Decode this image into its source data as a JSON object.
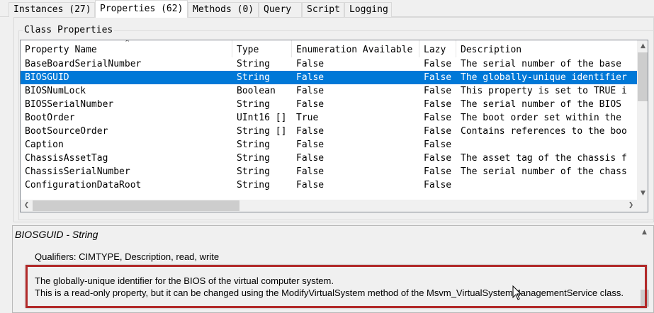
{
  "tabs": [
    {
      "label": "Instances (27)",
      "active": false
    },
    {
      "label": "Properties (62)",
      "active": true
    },
    {
      "label": "Methods (0)",
      "active": false
    },
    {
      "label": "Query",
      "active": false
    },
    {
      "label": "Script",
      "active": false
    },
    {
      "label": "Logging",
      "active": false
    }
  ],
  "class_properties": {
    "group_label": "Class Properties",
    "columns": [
      "Property Name",
      "Type",
      "Enumeration Available",
      "Lazy",
      "Description"
    ],
    "selected_index": 1,
    "rows": [
      [
        "BaseBoardSerialNumber",
        "String",
        "False",
        "False",
        "The serial number of the base"
      ],
      [
        "BIOSGUID",
        "String",
        "False",
        "False",
        "The globally-unique identifier"
      ],
      [
        "BIOSNumLock",
        "Boolean",
        "False",
        "False",
        "This property is set to TRUE i"
      ],
      [
        "BIOSSerialNumber",
        "String",
        "False",
        "False",
        "The serial number of the BIOS"
      ],
      [
        "BootOrder",
        "UInt16 []",
        "True",
        "False",
        "The boot order set within the"
      ],
      [
        "BootSourceOrder",
        "String []",
        "False",
        "False",
        "Contains references to the boo"
      ],
      [
        "Caption",
        "String",
        "False",
        "False",
        ""
      ],
      [
        "ChassisAssetTag",
        "String",
        "False",
        "False",
        "The asset tag of the chassis f"
      ],
      [
        "ChassisSerialNumber",
        "String",
        "False",
        "False",
        "The serial number of the chass"
      ],
      [
        "ConfigurationDataRoot",
        "String",
        "False",
        "False",
        ""
      ]
    ]
  },
  "detail": {
    "title": "BIOSGUID - String",
    "qualifiers": "Qualifiers: CIMTYPE, Description, read, write",
    "description_line1": "The globally-unique identifier for the BIOS of the virtual computer system.",
    "description_line2": "This is a read-only property, but it can be changed using the ModifyVirtualSystem method of the Msvm_VirtualSystemManagementService class."
  },
  "colors": {
    "selection": "#0078d7",
    "highlight_border": "#b22a2a"
  },
  "icons": [
    "sort-ascending-icon",
    "scroll-up-icon",
    "scroll-down-icon",
    "scroll-left-icon",
    "scroll-right-icon",
    "mouse-cursor-icon"
  ]
}
